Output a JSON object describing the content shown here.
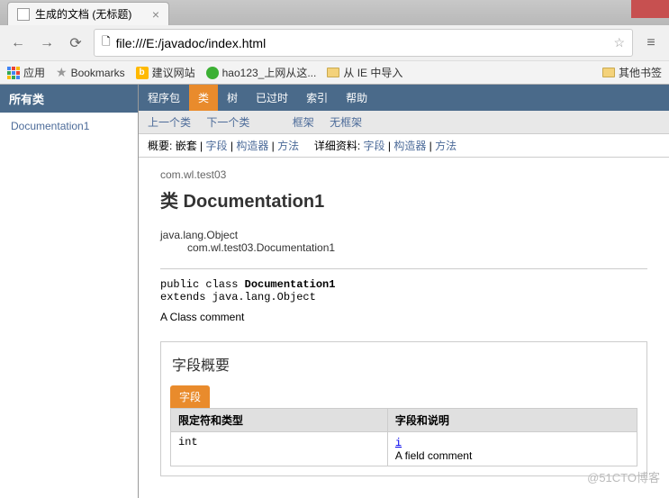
{
  "browser": {
    "tab_title": "生成的文档 (无标题)",
    "url": "file:///E:/javadoc/index.html"
  },
  "bookmarks": {
    "apps": "应用",
    "bookmarks": "Bookmarks",
    "suggest": "建议网站",
    "hao123": "hao123_上网从这...",
    "ie_import": "从 IE 中导入",
    "other": "其他书签"
  },
  "sidebar": {
    "header": "所有类",
    "items": [
      "Documentation1"
    ]
  },
  "topnav": {
    "items": [
      "程序包",
      "类",
      "树",
      "已过时",
      "索引",
      "帮助"
    ],
    "active_index": 1
  },
  "subnav": {
    "prev": "上一个类",
    "next": "下一个类",
    "frames": "框架",
    "noframes": "无框架"
  },
  "detailnav": {
    "summary_label": "概要:",
    "summary_items": [
      "嵌套",
      "字段",
      "构造器",
      "方法"
    ],
    "detail_label": "详细资料:",
    "detail_items": [
      "字段",
      "构造器",
      "方法"
    ]
  },
  "doc": {
    "package": "com.wl.test03",
    "class_heading": "类 Documentation1",
    "inheritance_parent": "java.lang.Object",
    "inheritance_child": "com.wl.test03.Documentation1",
    "signature_pre": "public class ",
    "signature_name": "Documentation1",
    "signature_ext": "extends java.lang.Object",
    "class_comment": "A Class comment",
    "field_section_title": "字段概要",
    "field_tab": "字段",
    "col_modifier": "限定符和类型",
    "col_field": "字段和说明",
    "fields": [
      {
        "type": "int",
        "name": "i",
        "comment": "A field comment"
      }
    ]
  },
  "watermark": "@51CTO博客"
}
